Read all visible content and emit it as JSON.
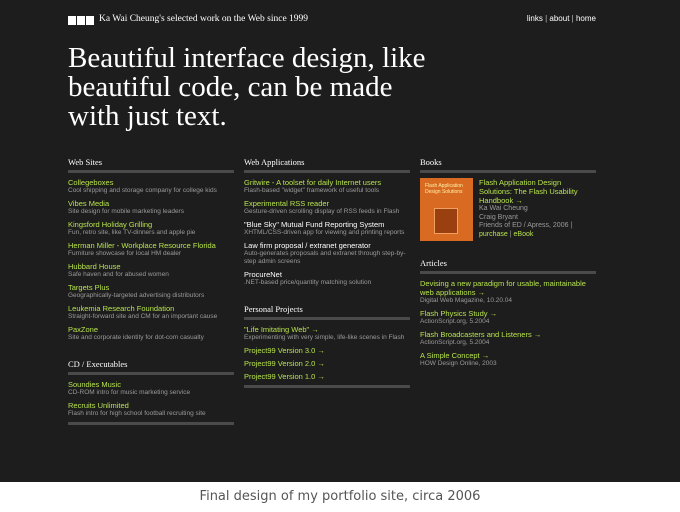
{
  "header": {
    "title": "Ka Wai Cheung's selected work on the Web since 1999",
    "links": [
      "links",
      "about",
      "home"
    ],
    "separator": "|"
  },
  "headline": "Beautiful interface design, like beautiful code, can be made with just text.",
  "web_sites": {
    "title": "Web Sites",
    "items": [
      {
        "title": "Collegeboxes",
        "desc": "Cool shipping and storage company for college kids"
      },
      {
        "title": "Vibes Media",
        "desc": "Site design for mobile marketing leaders"
      },
      {
        "title": "Kingsford Holiday Grilling",
        "desc": "Fun, retro site, like TV-dinners and apple pie"
      },
      {
        "title": "Herman Miller - Workplace Resource Florida",
        "desc": "Furniture showcase for local HM dealer"
      },
      {
        "title": "Hubbard House",
        "desc": "Safe haven and for abused women"
      },
      {
        "title": "Targets Plus",
        "desc": "Geographically-targeted advertising distributors"
      },
      {
        "title": "Leukemia Research Foundation",
        "desc": "Straight-forward site and CM for an important cause"
      },
      {
        "title": "PaxZone",
        "desc": "Site and corporate identity for dot-com casualty"
      }
    ]
  },
  "cd_executables": {
    "title": "CD / Executables",
    "items": [
      {
        "title": "Soundies Music",
        "desc": "CD-ROM intro for music marketing service"
      },
      {
        "title": "Recruits Unlimited",
        "desc": "Flash intro for high school football recruiting site"
      }
    ]
  },
  "web_applications": {
    "title": "Web Applications",
    "items": [
      {
        "title": "Gritwire - A toolset for daily Internet users",
        "desc": "Flash-based \"widget\" framework of useful tools"
      },
      {
        "title": "Experimental RSS reader",
        "desc": "Gesture-driven scrolling display of RSS feeds in Flash"
      },
      {
        "title": "\"Blue Sky\" Mutual Fund Reporting System",
        "desc": "XHTML/CSS-driven app for viewing and printing reports"
      },
      {
        "title": "Law firm proposal / extranet generator",
        "desc": "Auto-generates proposals and extranet through step-by-step admin screens"
      },
      {
        "title": "ProcureNet",
        "desc": ".NET-based price/quantity matching solution"
      }
    ]
  },
  "personal_projects": {
    "title": "Personal Projects",
    "items": [
      {
        "title": "\"Life Imitating Web\" →",
        "desc": "Experimenting with very simple, life-like scenes in Flash"
      },
      {
        "title": "Project99 Version 3.0 →",
        "desc": ""
      },
      {
        "title": "Project99 Version 2.0 →",
        "desc": ""
      },
      {
        "title": "Project99 Version 1.0 →",
        "desc": ""
      }
    ]
  },
  "books": {
    "title": "Books",
    "cover_text": "Flash Application Design Solutions",
    "book_title": "Flash Application Design Solutions: The Flash Usability Handbook →",
    "authors": [
      "Ka Wai Cheung",
      "Craig Bryant"
    ],
    "publisher": "Friends of ED / Apress, 2006 |",
    "links": [
      "purchase",
      "eBook"
    ],
    "link_sep": "|"
  },
  "articles": {
    "title": "Articles",
    "items": [
      {
        "title": "Devising a new paradigm for usable, maintainable web applications →",
        "desc": "Digital Web Magazine, 10.20.04"
      },
      {
        "title": "Flash Physics Study →",
        "desc": "ActionScript.org, 5.2004"
      },
      {
        "title": "Flash Broadcasters and Listeners →",
        "desc": "ActionScript.org, 5.2004"
      },
      {
        "title": "A Simple Concept →",
        "desc": "HOW Design Online, 2003"
      }
    ]
  },
  "caption": "Final design of my portfolio site, circa 2006",
  "colors": {
    "background": "#1d1d1d",
    "link": "#b7e34c",
    "text": "#ffffff",
    "muted": "#9a9a9a",
    "cover": "#d96a22"
  }
}
